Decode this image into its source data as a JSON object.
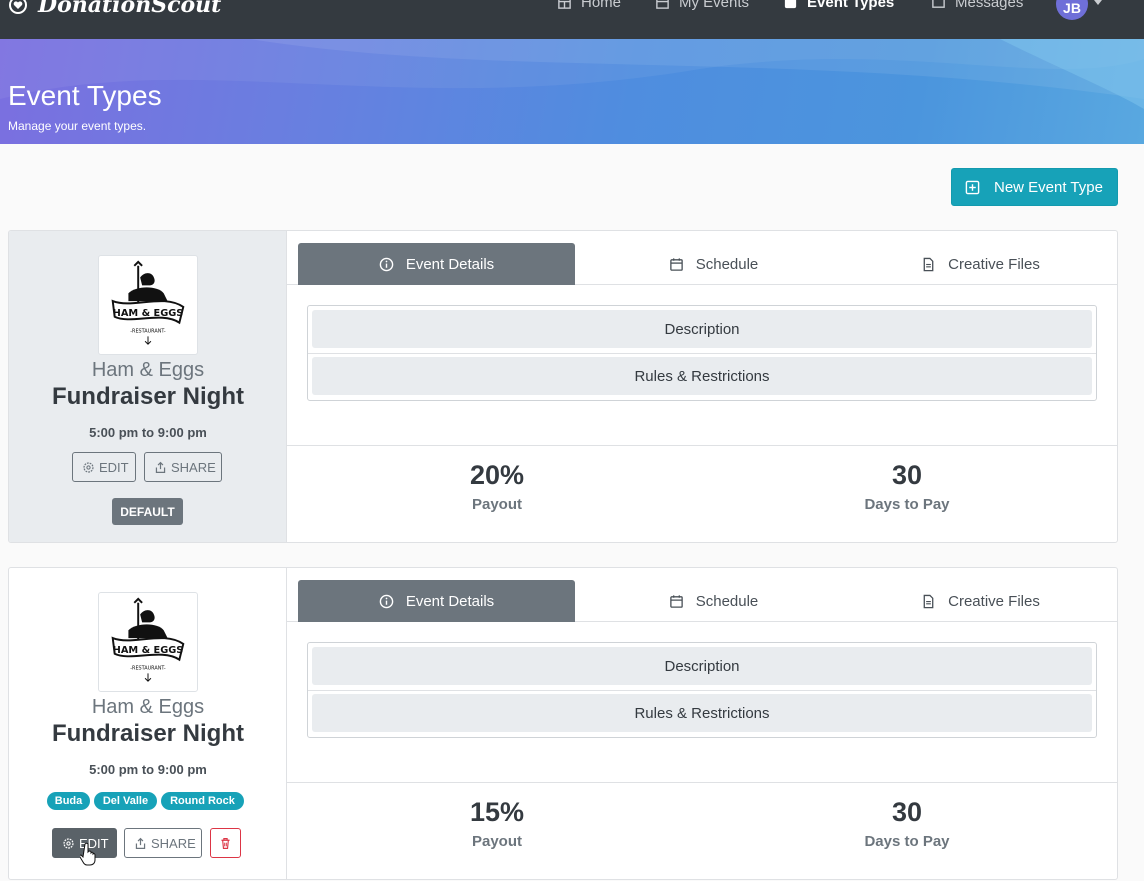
{
  "brand": {
    "name": "DonationScout"
  },
  "nav": {
    "items": [
      {
        "label": "Home",
        "icon": "home-icon"
      },
      {
        "label": "My Events",
        "icon": "calendar-icon"
      },
      {
        "label": "Event Types",
        "icon": "event-types-icon",
        "active": true
      },
      {
        "label": "Messages",
        "icon": "messages-icon"
      }
    ],
    "user_initials": "JB"
  },
  "hero": {
    "title": "Event Types",
    "subtitle": "Manage your event types."
  },
  "actions": {
    "new_event_type": "New Event Type"
  },
  "cards": [
    {
      "restaurant": "Ham & Eggs",
      "event_name": "Fundraiser Night",
      "time": "5:00 pm to 9:00 pm",
      "edit_label": "EDIT",
      "share_label": "SHARE",
      "default_badge": "DEFAULT",
      "tabs": [
        "Event Details",
        "Schedule",
        "Creative Files"
      ],
      "accordion": [
        "Description",
        "Rules & Restrictions"
      ],
      "payout_value": "20%",
      "payout_label": "Payout",
      "days_value": "30",
      "days_label": "Days to Pay"
    },
    {
      "restaurant": "Ham & Eggs",
      "event_name": "Fundraiser Night",
      "time": "5:00 pm to 9:00 pm",
      "locations": [
        "Buda",
        "Del Valle",
        "Round Rock"
      ],
      "edit_label": "EDIT",
      "share_label": "SHARE",
      "tabs": [
        "Event Details",
        "Schedule",
        "Creative Files"
      ],
      "accordion": [
        "Description",
        "Rules & Restrictions"
      ],
      "payout_value": "15%",
      "payout_label": "Payout",
      "days_value": "30",
      "days_label": "Days to Pay"
    }
  ],
  "logo_text": {
    "main": "HAM & EGGS",
    "sub": "-RESTAURANT-"
  },
  "colors": {
    "navbar": "#343a40",
    "info": "#17a2b8",
    "secondary": "#6c757d",
    "danger": "#dc3545"
  }
}
